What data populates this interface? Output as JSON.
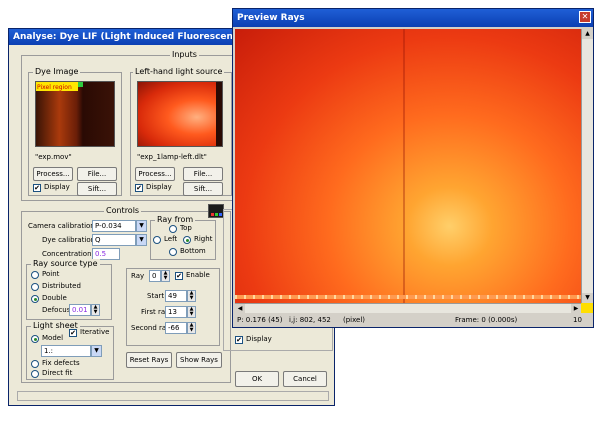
{
  "analyse": {
    "title": "Analyse: Dye LIF (Light Induced Fluorescence)",
    "inputs_label": "Inputs",
    "dye_image_label": "Dye Image",
    "pixel_region": "Pixel region",
    "dye_file": "\"exp.mov\"",
    "lefthand_label": "Left-hand light source",
    "lefthand_file": "\"exp_1lamp-left.dlt\"",
    "process_label": "Process...",
    "file_label": "File...",
    "display_label": "Display",
    "sift_label": "Sift...",
    "controls_label": "Controls",
    "camera_cal_label": "Camera calibration",
    "camera_cal_value": "P-0.034",
    "dye_cal_label": "Dye calibration",
    "dye_cal_value": "Q",
    "concentration_label": "Concentration",
    "concentration_value": "0.5",
    "ray_from_label": "Ray from",
    "top_label": "Top",
    "left_label": "Left",
    "right_label": "Right",
    "bottom_label": "Bottom",
    "ray_source_label": "Ray source type",
    "point_label": "Point",
    "distributed_label": "Distributed",
    "double_label": "Double",
    "defocus_label": "Defocus",
    "defocus_value": "0.01",
    "ray_label": "Ray",
    "ray_value": "0",
    "enable_label": "Enable",
    "start_label": "Start",
    "start_value": "49",
    "first_ray_label": "First ray",
    "first_ray_value": "13",
    "second_ray_label": "Second ray",
    "second_ray_value": "-66",
    "light_sheet_label": "Light sheet",
    "model_label": "Model",
    "iterative_label": "Iterative",
    "model_value": "1.:",
    "fix_defects_label": "Fix defects",
    "direct_fit_label": "Direct fit",
    "reset_rays_label": "Reset Rays",
    "show_rays_label": "Show Rays",
    "ok_label": "OK",
    "cancel_label": "Cancel",
    "display2_label": "Display"
  },
  "preview": {
    "title": "Preview Rays",
    "status_pos": "P: 0.176 (45)",
    "status_ij": "i,j: 802, 452",
    "status_unit": "(pixel)",
    "status_frame": "Frame: 0 (0.000s)",
    "status_zoom": "10"
  }
}
